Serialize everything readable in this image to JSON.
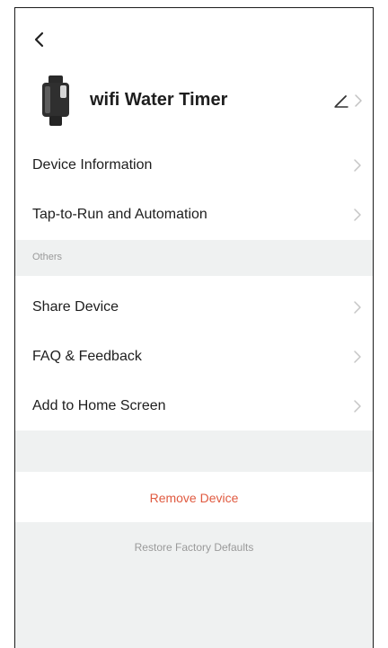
{
  "header": {
    "back_icon": "chevron-left-icon",
    "device_icon": "water-timer-icon",
    "device_name": "wifi Water Timer",
    "edit_icon": "pencil-icon"
  },
  "menu": {
    "device_information": "Device Information",
    "tap_to_run": "Tap-to-Run and Automation",
    "section_others": "Others",
    "share_device": "Share Device",
    "faq_feedback": "FAQ & Feedback",
    "add_to_home": "Add to Home Screen"
  },
  "actions": {
    "remove_device": "Remove Device",
    "restore_factory": "Restore Factory Defaults"
  },
  "colors": {
    "danger": "#e05a40",
    "section_bg": "#eff1f1",
    "muted_text": "#9a9a9a"
  }
}
